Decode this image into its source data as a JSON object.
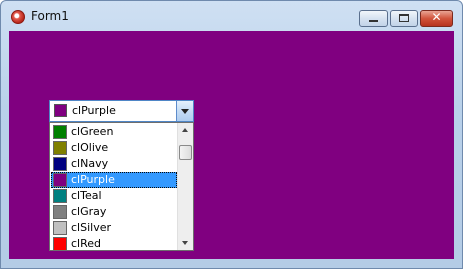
{
  "window": {
    "title": "Form1",
    "close_glyph": "✕"
  },
  "form": {
    "client_color": "#800080"
  },
  "combo": {
    "selected_label": "clPurple",
    "selected_color": "#800080"
  },
  "dropdown": {
    "items": [
      {
        "label": "clGreen",
        "color": "#008000"
      },
      {
        "label": "clOlive",
        "color": "#808000"
      },
      {
        "label": "clNavy",
        "color": "#000080"
      },
      {
        "label": "clPurple",
        "color": "#800080",
        "selected": true
      },
      {
        "label": "clTeal",
        "color": "#008080"
      },
      {
        "label": "clGray",
        "color": "#808080"
      },
      {
        "label": "clSilver",
        "color": "#c0c0c0"
      },
      {
        "label": "clRed",
        "color": "#ff0000"
      }
    ]
  }
}
